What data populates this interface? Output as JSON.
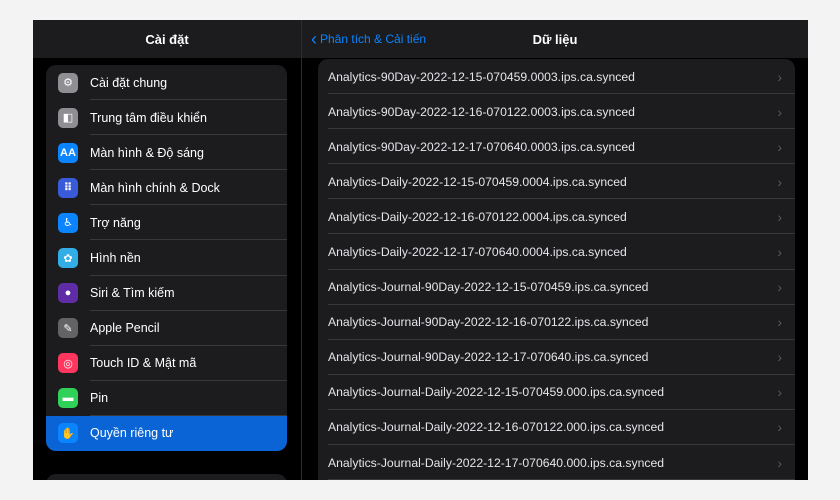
{
  "sidebar": {
    "title": "Cài đặt",
    "items": [
      {
        "label": "Cài đặt chung",
        "icon": "gear-icon",
        "glyph": "⚙",
        "color": "#8e8e93"
      },
      {
        "label": "Trung tâm điều khiển",
        "icon": "control-center-icon",
        "glyph": "◧",
        "color": "#8e8e93"
      },
      {
        "label": "Màn hình & Độ sáng",
        "icon": "display-brightness-icon",
        "glyph": "AA",
        "color": "#0a84ff"
      },
      {
        "label": "Màn hình chính & Dock",
        "icon": "home-screen-icon",
        "glyph": "⠿",
        "color": "#3a5bd9"
      },
      {
        "label": "Trợ năng",
        "icon": "accessibility-icon",
        "glyph": "♿",
        "color": "#0a84ff"
      },
      {
        "label": "Hình nền",
        "icon": "wallpaper-icon",
        "glyph": "✿",
        "color": "#32ade6"
      },
      {
        "label": "Siri & Tìm kiếm",
        "icon": "siri-icon",
        "glyph": "●",
        "color": "#5e2ca5"
      },
      {
        "label": "Apple Pencil",
        "icon": "pencil-icon",
        "glyph": "✎",
        "color": "#636366"
      },
      {
        "label": "Touch ID & Mật mã",
        "icon": "fingerprint-icon",
        "glyph": "◎",
        "color": "#ff375f"
      },
      {
        "label": "Pin",
        "icon": "battery-icon",
        "glyph": "▬",
        "color": "#30d158"
      },
      {
        "label": "Quyền riêng tư",
        "icon": "privacy-hand-icon",
        "glyph": "✋",
        "color": "#0a84ff",
        "selected": true
      }
    ]
  },
  "detail": {
    "back_label": "Phân tích & Cải tiến",
    "title": "Dữ liệu",
    "files": [
      "Analytics-90Day-2022-12-15-070459.0003.ips.ca.synced",
      "Analytics-90Day-2022-12-16-070122.0003.ips.ca.synced",
      "Analytics-90Day-2022-12-17-070640.0003.ips.ca.synced",
      "Analytics-Daily-2022-12-15-070459.0004.ips.ca.synced",
      "Analytics-Daily-2022-12-16-070122.0004.ips.ca.synced",
      "Analytics-Daily-2022-12-17-070640.0004.ips.ca.synced",
      "Analytics-Journal-90Day-2022-12-15-070459.ips.ca.synced",
      "Analytics-Journal-90Day-2022-12-16-070122.ips.ca.synced",
      "Analytics-Journal-90Day-2022-12-17-070640.ips.ca.synced",
      "Analytics-Journal-Daily-2022-12-15-070459.000.ips.ca.synced",
      "Analytics-Journal-Daily-2022-12-16-070122.000.ips.ca.synced",
      "Analytics-Journal-Daily-2022-12-17-070640.000.ips.ca.synced"
    ]
  },
  "colors": {
    "accent": "#0a84ff",
    "selected_bg": "#0a64d6",
    "row_bg": "#1c1c1e"
  }
}
